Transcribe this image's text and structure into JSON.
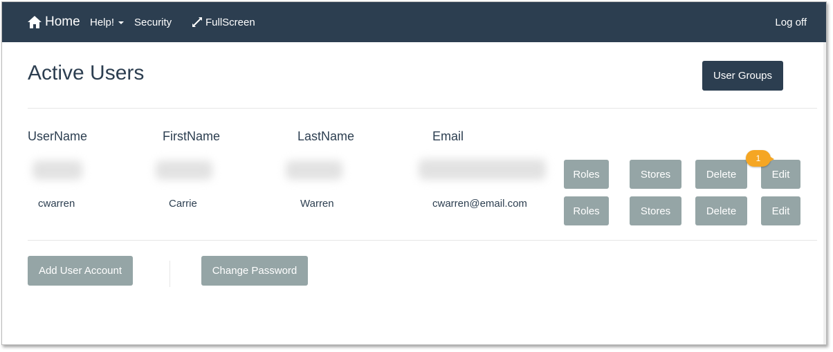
{
  "navbar": {
    "home_label": "Home",
    "help_label": "Help!",
    "security_label": "Security",
    "fullscreen_label": "FullScreen",
    "logoff_label": "Log off"
  },
  "page": {
    "title": "Active Users",
    "user_groups_label": "User Groups"
  },
  "table": {
    "headers": [
      "UserName",
      "FirstName",
      "LastName",
      "Email"
    ],
    "rows": [
      {
        "username": "",
        "firstname": "",
        "lastname": "",
        "email": "",
        "redacted": true
      },
      {
        "username": "cwarren",
        "firstname": "Carrie",
        "lastname": "Warren",
        "email": "cwarren@email.com",
        "redacted": false
      }
    ],
    "row_actions": {
      "roles": "Roles",
      "stores": "Stores",
      "delete": "Delete",
      "edit": "Edit"
    }
  },
  "footer_actions": {
    "add_user_label": "Add User Account",
    "change_password_label": "Change Password"
  },
  "callout": {
    "number": "1"
  },
  "colors": {
    "navbar": "#2c3e50",
    "button_gray": "#95a5a6",
    "button_dark": "#2c3e50",
    "callout": "#f5a623"
  }
}
